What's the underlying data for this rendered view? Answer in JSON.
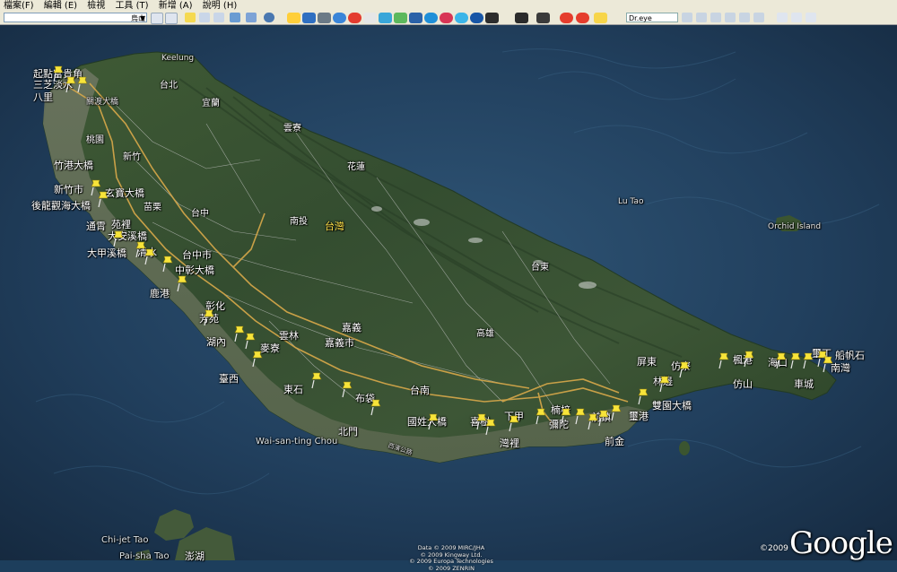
{
  "menubar": {
    "items": [
      "檔案(F)",
      "編輯 (E)",
      "檢視",
      "工具 (T)",
      "新增 (A)",
      "說明 (H)"
    ]
  },
  "toolbar": {
    "search_value": "烏山",
    "dreye_label": "Dr.eye"
  },
  "map": {
    "attribution": [
      "Data © 2009 MIRC/JHA",
      "© 2009 Kingway Ltd.",
      "© 2009 Europa Technologies",
      "© 2009 ZENRIN"
    ],
    "copyright": "©2009",
    "logo": "Google",
    "sea_labels": {
      "wai_san": "Wai-san-ting Chou",
      "chi_jet": "Chi-jet Tao",
      "pai_sha": "Pai-sha Tao",
      "lutao": "Lu Tao",
      "orchid": "Orchid Island",
      "penghu": "澎湖"
    },
    "place_labels": {
      "taiwan": "台灣",
      "taipei": "台北",
      "yilan": "宜蘭",
      "hualien": "花蓮",
      "taitung": "台東",
      "kaohsiung": "高雄",
      "tainan": "台南",
      "chiayi": "嘉義",
      "chiayi_city": "嘉義市",
      "yunlin": "雲林",
      "nantou": "南投",
      "taichung_small": "台中",
      "taichung_city": "台中市",
      "changhua": "彰化",
      "miaoli": "苗栗",
      "hsinchu": "新竹",
      "taoyuan": "桃園",
      "pingtung": "屏東",
      "keelung": "Keelung"
    },
    "route_labels": {
      "start": "起點富貴角",
      "sanzhi": "三芝淡水",
      "bali": "八里",
      "guandu": "關渡大橋",
      "zhugang": "竹港大橋",
      "hsinchu_city": "新竹市",
      "xuanbao": "玄寶大橋",
      "houlong": "後龍觀海大橋",
      "tongxiao": "通霄",
      "yuanli": "苑裡",
      "daan": "大安溪橋",
      "dajia": "大甲溪橋",
      "qingshui": "清水",
      "zhongzhang": "中彰大橋",
      "lugang": "鹿港",
      "fangyuan": "芳苑",
      "hunei": "湖內",
      "mailiao": "麥寮",
      "taixi": "臺西",
      "dongshi": "東石",
      "budai": "布袋",
      "beimen": "北門",
      "guoxing": "國姓大橋",
      "xishu": "喜樹",
      "wanli": "灣裡",
      "xiajia": "下甲",
      "nanzi": "楠梓",
      "mituo": "彌陀",
      "qianzhen": "前鎮",
      "qianjin": "前金",
      "xigang": "璽港",
      "shuangyuan": "雙園大橋",
      "linbian": "林邊",
      "fangliao": "仿寮",
      "fenggang": "楓港",
      "fangshan": "仿山",
      "haikou": "海口",
      "checheng": "車城",
      "xiding": "璽丁",
      "chuanfanshi": "船帆石",
      "nanwan": "南灣",
      "provincial_road": "西濱公路"
    }
  }
}
